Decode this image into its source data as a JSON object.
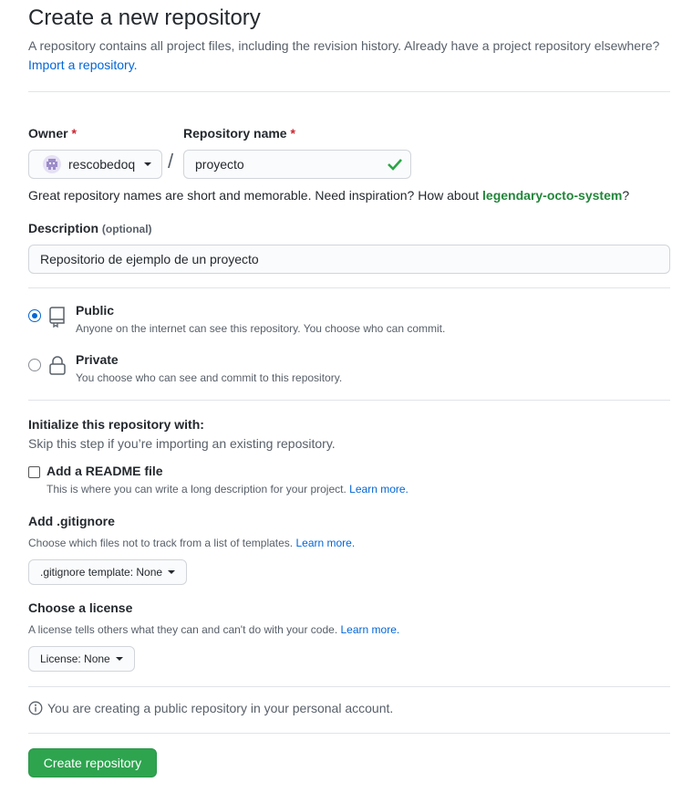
{
  "header": {
    "title": "Create a new repository",
    "subtitle": "A repository contains all project files, including the revision history. Already have a project repository elsewhere?",
    "import_link": "Import a repository."
  },
  "owner": {
    "label": "Owner",
    "required_mark": "*",
    "value": "rescobedoq"
  },
  "separator": "/",
  "repo_name": {
    "label": "Repository name",
    "required_mark": "*",
    "value": "proyecto"
  },
  "hint": {
    "text": "Great repository names are short and memorable. Need inspiration? How about",
    "suggestion": "legendary-octo-system",
    "end": "?"
  },
  "description": {
    "label": "Description",
    "optional": "(optional)",
    "value": "Repositorio de ejemplo de un proyecto"
  },
  "visibility": {
    "options": [
      {
        "title": "Public",
        "desc": "Anyone on the internet can see this repository. You choose who can commit.",
        "selected": true,
        "icon": "repo-icon"
      },
      {
        "title": "Private",
        "desc": "You choose who can see and commit to this repository.",
        "selected": false,
        "icon": "lock-icon"
      }
    ]
  },
  "init": {
    "title": "Initialize this repository with:",
    "subtitle": "Skip this step if you’re importing an existing repository.",
    "readme": {
      "label": "Add a README file",
      "desc": "This is where you can write a long description for your project.",
      "learn": "Learn more.",
      "checked": false
    }
  },
  "gitignore": {
    "title": "Add .gitignore",
    "desc": "Choose which files not to track from a list of templates.",
    "learn": "Learn more.",
    "button": ".gitignore template: None"
  },
  "license": {
    "title": "Choose a license",
    "desc": "A license tells others what they can and can't do with your code.",
    "learn": "Learn more.",
    "button": "License: None"
  },
  "info": {
    "text": "You are creating a public repository in your personal account."
  },
  "submit": {
    "label": "Create repository"
  },
  "colors": {
    "primary_button": "#2ea44f",
    "link": "#0366d6",
    "success": "#22863a",
    "required": "#cb2431"
  }
}
